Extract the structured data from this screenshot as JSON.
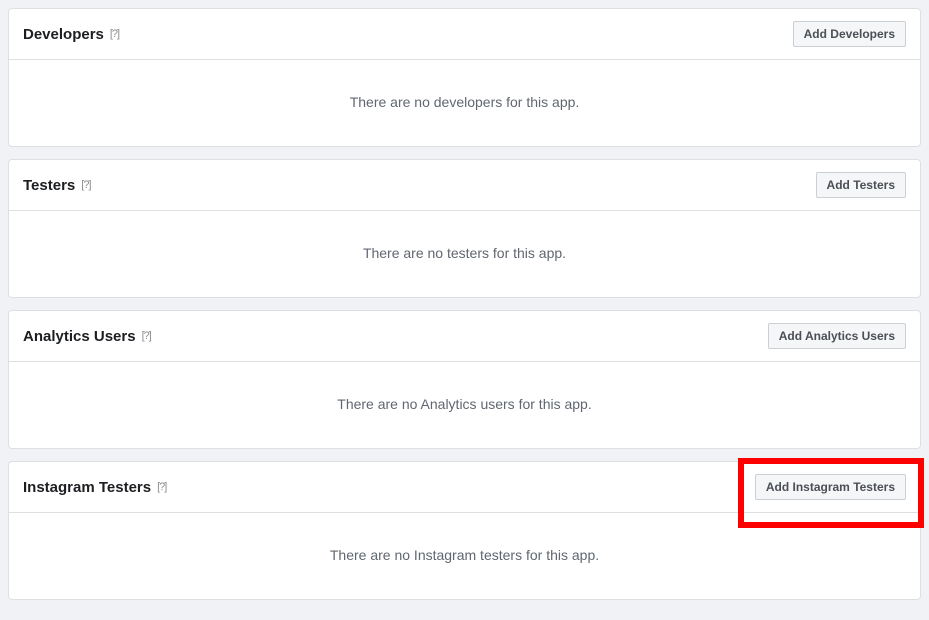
{
  "sections": [
    {
      "title": "Developers",
      "button_label": "Add Developers",
      "empty_message": "There are no developers for this app.",
      "highlighted": false
    },
    {
      "title": "Testers",
      "button_label": "Add Testers",
      "empty_message": "There are no testers for this app.",
      "highlighted": false
    },
    {
      "title": "Analytics Users",
      "button_label": "Add Analytics Users",
      "empty_message": "There are no Analytics users for this app.",
      "highlighted": false
    },
    {
      "title": "Instagram Testers",
      "button_label": "Add Instagram Testers",
      "empty_message": "There are no Instagram testers for this app.",
      "highlighted": true
    }
  ],
  "help_icon_text": "[?]"
}
